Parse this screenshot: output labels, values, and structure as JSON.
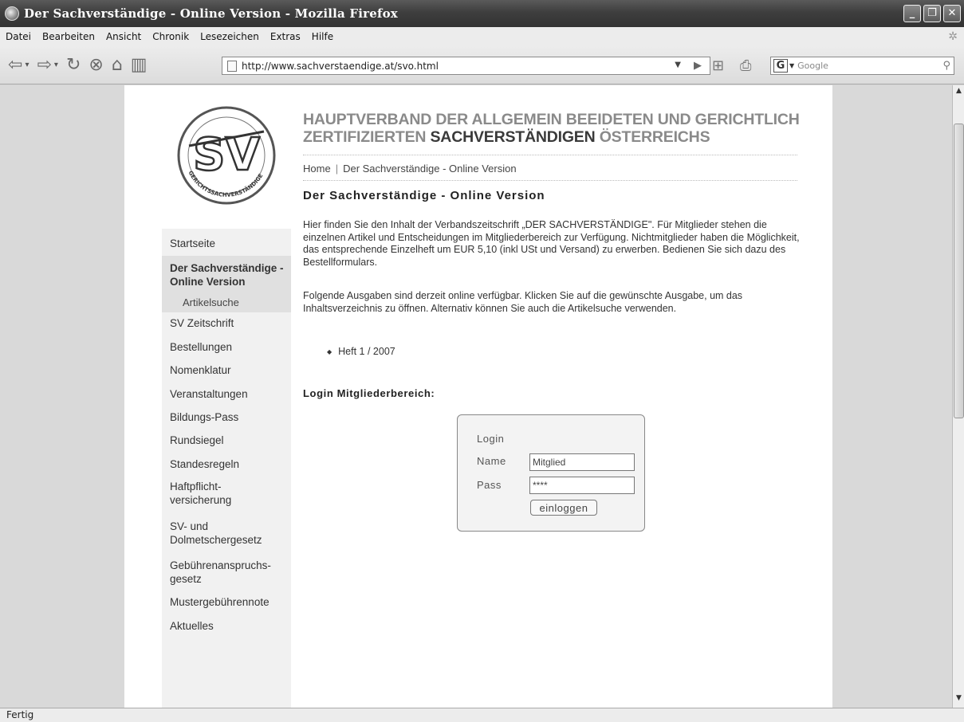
{
  "window": {
    "title": "Der Sachverständige - Online Version - Mozilla Firefox",
    "minimize": "_",
    "maximize": "❐",
    "close": "✕"
  },
  "menu": [
    "Datei",
    "Bearbeiten",
    "Ansicht",
    "Chronik",
    "Lesezeichen",
    "Extras",
    "Hilfe"
  ],
  "toolbar": {
    "url": "http://www.sachverstaendige.at/svo.html",
    "search_placeholder": "Google",
    "search_engine": "G"
  },
  "sidebar": {
    "items": [
      {
        "label": "Startseite"
      },
      {
        "label": "Der Sachverständige - Online Version"
      },
      {
        "label": "Artikelsuche"
      },
      {
        "label": "SV Zeitschrift"
      },
      {
        "label": "Bestellungen"
      },
      {
        "label": "Nomenklatur"
      },
      {
        "label": "Veranstaltungen"
      },
      {
        "label": "Bildungs-Pass"
      },
      {
        "label": "Rundsiegel"
      },
      {
        "label": "Standesregeln"
      },
      {
        "label": "Haftpflicht-versicherung"
      },
      {
        "label": "SV- und Dolmetschergesetz"
      },
      {
        "label": "Gebührenanspruchs-gesetz"
      },
      {
        "label": "Mustergebührennote"
      },
      {
        "label": "Aktuelles"
      }
    ]
  },
  "logo": {
    "letters": "SV",
    "ring_text": "GERICHTSSACHVERSTÄNDIGE"
  },
  "main": {
    "heading_part1": "HAUPTVERBAND DER ALLGEMEIN BEEIDETEN UND GERICHTLICH ZERTIFIZIERTEN ",
    "heading_part2": "SACHVERSTÄNDIGEN",
    "heading_part3": " ÖSTERREICHS",
    "breadcrumb": [
      "Home",
      "Der Sachverständige - Online Version"
    ],
    "breadcrumb_separator": "|",
    "page_title": "Der Sachverständige - Online Version",
    "paragraph1": "Hier finden Sie den Inhalt der Verbandszeitschrift „DER SACHVERSTÄNDIGE\". Für Mitglieder stehen die einzelnen Artikel und Entscheidungen im Mitgliederbereich zur Verfügung. Nichtmitglieder haben die Möglichkeit, das entsprechende Einzelheft um EUR 5,10 (inkl USt und Versand) zu erwerben. Bedienen Sie sich dazu des Bestellformulars.",
    "paragraph2": "Folgende Ausgaben sind derzeit online verfügbar. Klicken Sie auf die gewünschte Ausgabe, um das Inhaltsverzeichnis zu öffnen. Alternativ können Sie auch die Artikelsuche verwenden.",
    "issue": "Heft 1 / 2007",
    "login_heading": "Login Mitgliederbereich:"
  },
  "login": {
    "title": "Login",
    "name_label": "Name",
    "name_value": "Mitglied",
    "pass_label": "Pass",
    "pass_value": "****",
    "submit": "einloggen"
  },
  "status": "Fertig"
}
